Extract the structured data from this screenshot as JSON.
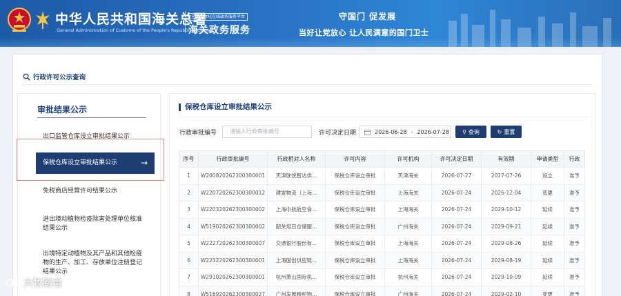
{
  "header": {
    "title_cn": "中华人民共和国海关总署",
    "title_en": "General Administration of Customs of the People's Republic of China",
    "platform_tag": "全国一体化在线政务服务平台",
    "platform_name": "海关政务服务",
    "slogan1": "守国门 促发展",
    "slogan2": "当好让党放心 让人民满意的国门卫士"
  },
  "breadcrumb": {
    "label": "行政许可公示查询"
  },
  "sidebar": {
    "title": "审批结果公示",
    "items": [
      {
        "label": "出口监管仓库设立审批结果公示",
        "active": false
      },
      {
        "label": "保税仓库设立审批结果公示",
        "active": true
      },
      {
        "label": "免税商店经营许可结果公示",
        "active": false
      },
      {
        "label": "进出境动植物检疫除害处理单位核准结果公示",
        "active": false
      },
      {
        "label": "出境特定动植物及其产品和其他检疫物的生产、加工、存放单位注册登记结果公示",
        "active": false
      }
    ]
  },
  "panel": {
    "title": "保税仓库设立审批结果公示",
    "filters": {
      "approval_no_label": "行政审批编号",
      "approval_no_placeholder": "请输入行政审批编号",
      "date_label": "许可决定日期",
      "date_start": "2026-06-28",
      "date_sep": "-",
      "date_end": "2026-07-28",
      "search_label": "查询",
      "reset_label": "重置"
    },
    "table": {
      "headers": [
        "序号",
        "行政审批编号",
        "行政相对人名称",
        "许可内容",
        "许可机构",
        "许可决定日期",
        "有效期",
        "申请类型",
        "行政"
      ],
      "rows": [
        [
          "1",
          "W2008202623003000​01",
          "天津联悦智达供...",
          "保税仓库设立审批",
          "天津海关",
          "2026-07-27",
          "2027-07-26",
          "设立",
          "准予"
        ],
        [
          "2",
          "W2207202623003000​12",
          "建发物流（上海...",
          "保税仓库设立审批",
          "上海海关",
          "2026-07-24",
          "2026-12-04",
          "变更",
          "准予"
        ],
        [
          "3",
          "W2203202623003000​02",
          "上海中航航空食...",
          "保税仓库设立审批",
          "上海海关",
          "2026-07-24",
          "2029-10-12",
          "延续",
          "准予"
        ],
        [
          "4",
          "W5190202623003000​02",
          "韶关坦日仓储服...",
          "保税仓库设立审批",
          "广州海关",
          "2026-07-24",
          "2029-09-21",
          "延续",
          "准予"
        ],
        [
          "5",
          "W2227202623003000​07",
          "交通银行股份有...",
          "保税仓库设立审批",
          "上海海关",
          "2026-07-24",
          "2029-08-26",
          "延续",
          "准予"
        ],
        [
          "6",
          "W2232202623003000​01",
          "上海国创供应链...",
          "保税仓库设立审批",
          "上海海关",
          "2026-07-24",
          "2029-08-19",
          "延续",
          "准予"
        ],
        [
          "7",
          "W2910202623003000​01",
          "杭州萧山国际机...",
          "保税仓库设立审批",
          "杭州海关",
          "2026-07-24",
          "2029-10-09",
          "延续",
          "准予"
        ],
        [
          "8",
          "W5169202623003000​27",
          "广州发展粮积物...",
          "保税仓库设立审批",
          "广州海关",
          "2026-07-24",
          "2029-02-10",
          "变更",
          "准予"
        ]
      ]
    }
  },
  "watermark": "大牧路境",
  "colors": {
    "header_blue": "#2a73c6",
    "nav_dark": "#1e3e73",
    "highlight_red": "#e08080"
  }
}
